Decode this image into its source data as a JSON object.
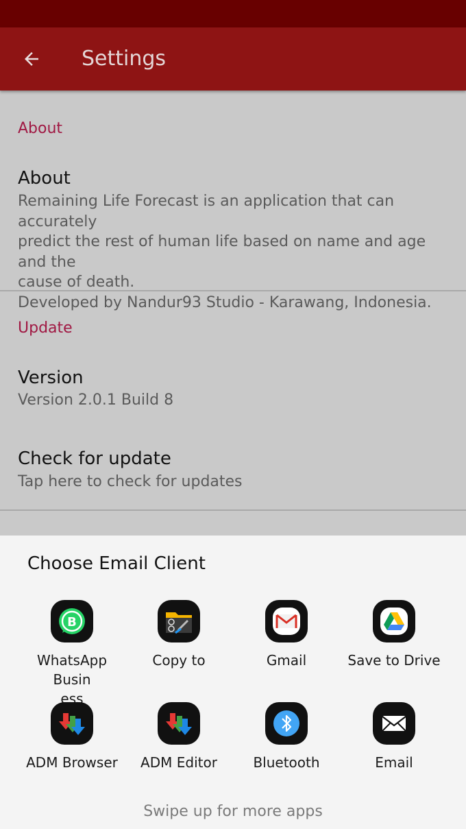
{
  "app_bar": {
    "title": "Settings"
  },
  "settings": {
    "about_section": {
      "header": "About",
      "item": {
        "title": "About",
        "summary_lines": [
          "Remaining Life Forecast is an application that can accurately",
          "predict the rest of human life based on name and age and the",
          "cause of death.",
          "Developed by Nandur93 Studio - Karawang, Indonesia."
        ]
      }
    },
    "update_section": {
      "header": "Update",
      "version": {
        "title": "Version",
        "summary": "Version 2.0.1 Build 8"
      },
      "check": {
        "title": "Check for update",
        "summary": "Tap here to check for updates"
      }
    }
  },
  "chooser": {
    "title": "Choose Email Client",
    "apps": [
      {
        "label_lines": [
          "WhatsApp Busin",
          "ess"
        ],
        "icon": "whatsapp-business-icon"
      },
      {
        "label_lines": [
          "Copy to"
        ],
        "icon": "copy-to-icon"
      },
      {
        "label_lines": [
          "Gmail"
        ],
        "icon": "gmail-icon"
      },
      {
        "label_lines": [
          "Save to Drive"
        ],
        "icon": "google-drive-icon"
      },
      {
        "label_lines": [
          "ADM Browser"
        ],
        "icon": "adm-browser-icon"
      },
      {
        "label_lines": [
          "ADM Editor"
        ],
        "icon": "adm-editor-icon"
      },
      {
        "label_lines": [
          "Bluetooth"
        ],
        "icon": "bluetooth-icon"
      },
      {
        "label_lines": [
          "Email"
        ],
        "icon": "email-icon"
      }
    ],
    "hint": "Swipe up for more apps"
  },
  "colors": {
    "status_bar": "#680000",
    "app_bar": "#8e1414",
    "section_header": "#a01843",
    "whatsapp_green": "#25d366",
    "bluetooth_blue": "#42a5f5"
  }
}
